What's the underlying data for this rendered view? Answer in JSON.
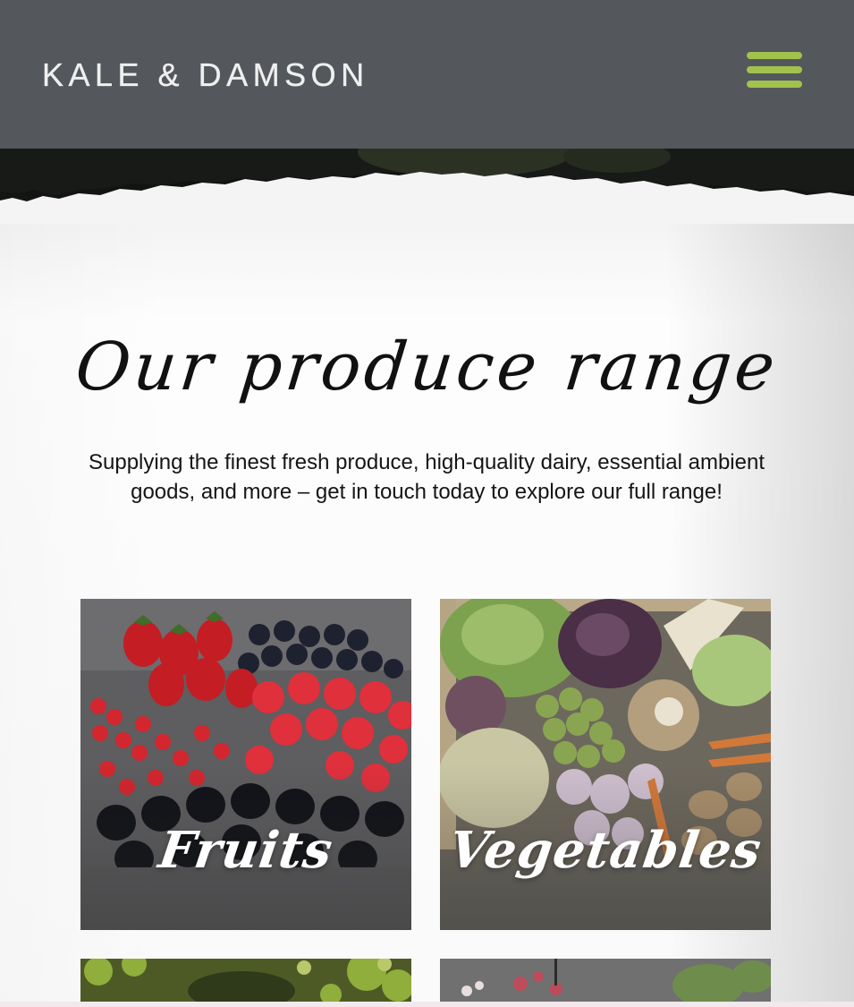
{
  "header": {
    "brand": "KALE & DAMSON",
    "menu_icon": "hamburger-menu-icon",
    "background_color": "#54585c",
    "accent_color": "#a1c24d"
  },
  "main": {
    "heading": "Our produce range",
    "intro": "Supplying the finest fresh produce, high-quality dairy, essential ambient goods, and more – get in touch today to explore our full range!"
  },
  "categories": [
    {
      "label": "Fruits",
      "image": "berries-photo"
    },
    {
      "label": "Vegetables",
      "image": "vegetable-crate-photo"
    },
    {
      "label": "",
      "image": "salad-leaves-photo"
    },
    {
      "label": "",
      "image": "microgreens-photo"
    }
  ]
}
